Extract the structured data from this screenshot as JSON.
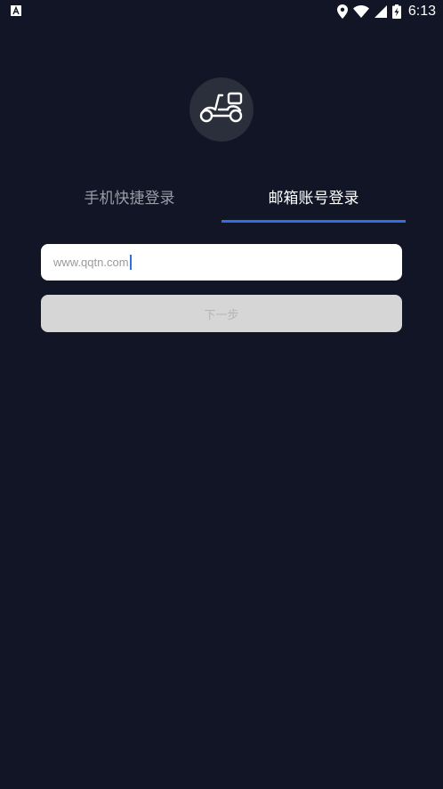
{
  "status_bar": {
    "time": "6:13",
    "icons": [
      "app-notification-icon",
      "location-icon",
      "wifi-icon",
      "signal-icon",
      "battery-charging-icon"
    ]
  },
  "logo": {
    "icon": "scooter-icon"
  },
  "tabs": [
    {
      "label": "手机快捷登录",
      "active": false
    },
    {
      "label": "邮箱账号登录",
      "active": true
    }
  ],
  "email_input": {
    "value": "www.qqtn.com"
  },
  "next_button": {
    "label": "下一步",
    "enabled": false
  },
  "colors": {
    "background": "#111526",
    "accent": "#2f6fe0",
    "inactive_tab": "#9a9ca6",
    "button_disabled": "#d6d6d6"
  }
}
